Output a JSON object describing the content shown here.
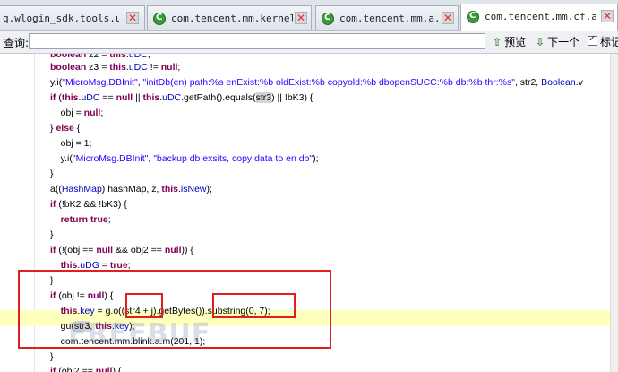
{
  "tabs": [
    {
      "label": "q.wlogin_sdk.tools.util",
      "icon": "class-file-icon",
      "active": false
    },
    {
      "label": "com.tencent.mm.kernel.a",
      "icon": "class-file-icon",
      "active": false
    },
    {
      "label": "com.tencent.mm.a.o",
      "icon": "class-file-icon",
      "active": false
    },
    {
      "label": "com.tencent.mm.cf.a",
      "icon": "class-file-icon",
      "active": true
    }
  ],
  "find_bar": {
    "label": "查询:",
    "value": "",
    "prev_label": "预览",
    "next_label": "下一个",
    "mark_label": "标记",
    "mark_checked": true
  },
  "code": {
    "lines": [
      "boolean z2 = this.uDC;",
      "boolean z3 = this.uDC != null;",
      "y.i(\"MicroMsg.DBInit\", \"initDb(en) path:%s enExist:%b oldExist:%b copyold:%b dbopenSUCC:%b db:%b thr:%s\", str2, Boolean.v",
      "if (this.uDC == null || this.uDC.getPath().equals(str3) || !bK3) {",
      "    obj = null;",
      "} else {",
      "    obj = 1;",
      "    y.i(\"MicroMsg.DBInit\", \"backup db exsits, copy data to en db\");",
      "}",
      "a((HashMap) hashMap, z, this.isNew);",
      "if (!bK2 && !bK3) {",
      "    return true;",
      "}",
      "if (!(obj == null && obj2 == null)) {",
      "    this.uDG = true;",
      "}",
      "if (obj != null) {",
      "    this.key = g.o((str4 + j).getBytes()).substring(0, 7);",
      "    gu(str3, this.key);",
      "    com.tencent.mm.blink.a.m(201, 1);",
      "}",
      "if (obj2 == null) {"
    ]
  },
  "watermark": "FREEBUF",
  "colors": {
    "keyword": "#7f0055",
    "string": "#2a00ff",
    "field": "#0000c0",
    "annotation": "#e02020",
    "current_line": "#ffffc0"
  }
}
